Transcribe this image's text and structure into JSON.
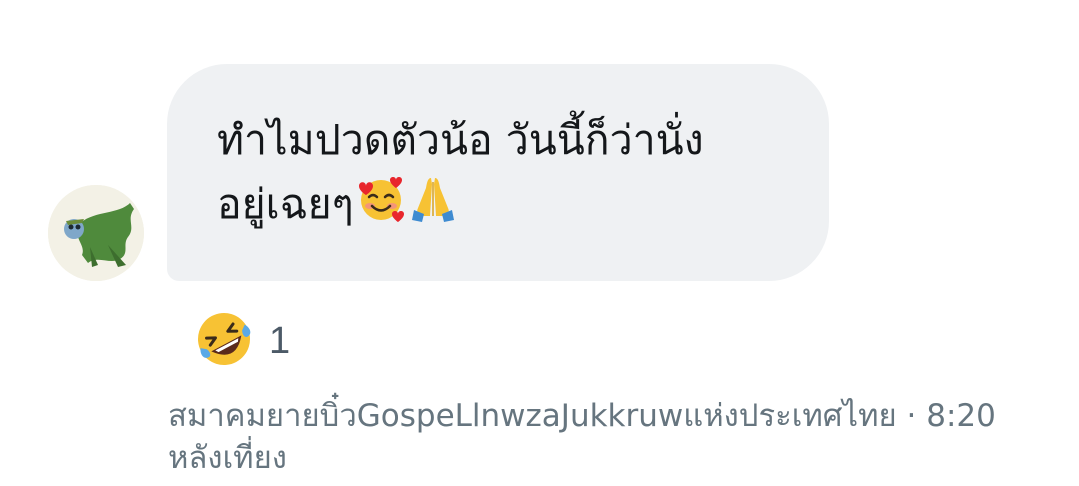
{
  "message": {
    "line1": "ทำไมปวดตัวน้อ วันนี้ก็ว่านั่ง",
    "line2": "อยู่เฉยๆ",
    "emojis": [
      "smiling-face-with-hearts",
      "folded-hands"
    ]
  },
  "reaction": {
    "emoji": "rolling-on-the-floor-laughing",
    "count": "1"
  },
  "meta": {
    "sender": "สมาคมยายบิ๋วGospeLlnwzaJukkruwแห่งประเทศไทย",
    "separator": " · ",
    "time": "8:20 หลังเที่ยง"
  },
  "colors": {
    "bubble": "#eff1f3",
    "message_text": "#14171a",
    "meta_text": "#66757f",
    "reaction_count": "#4c5a67"
  }
}
